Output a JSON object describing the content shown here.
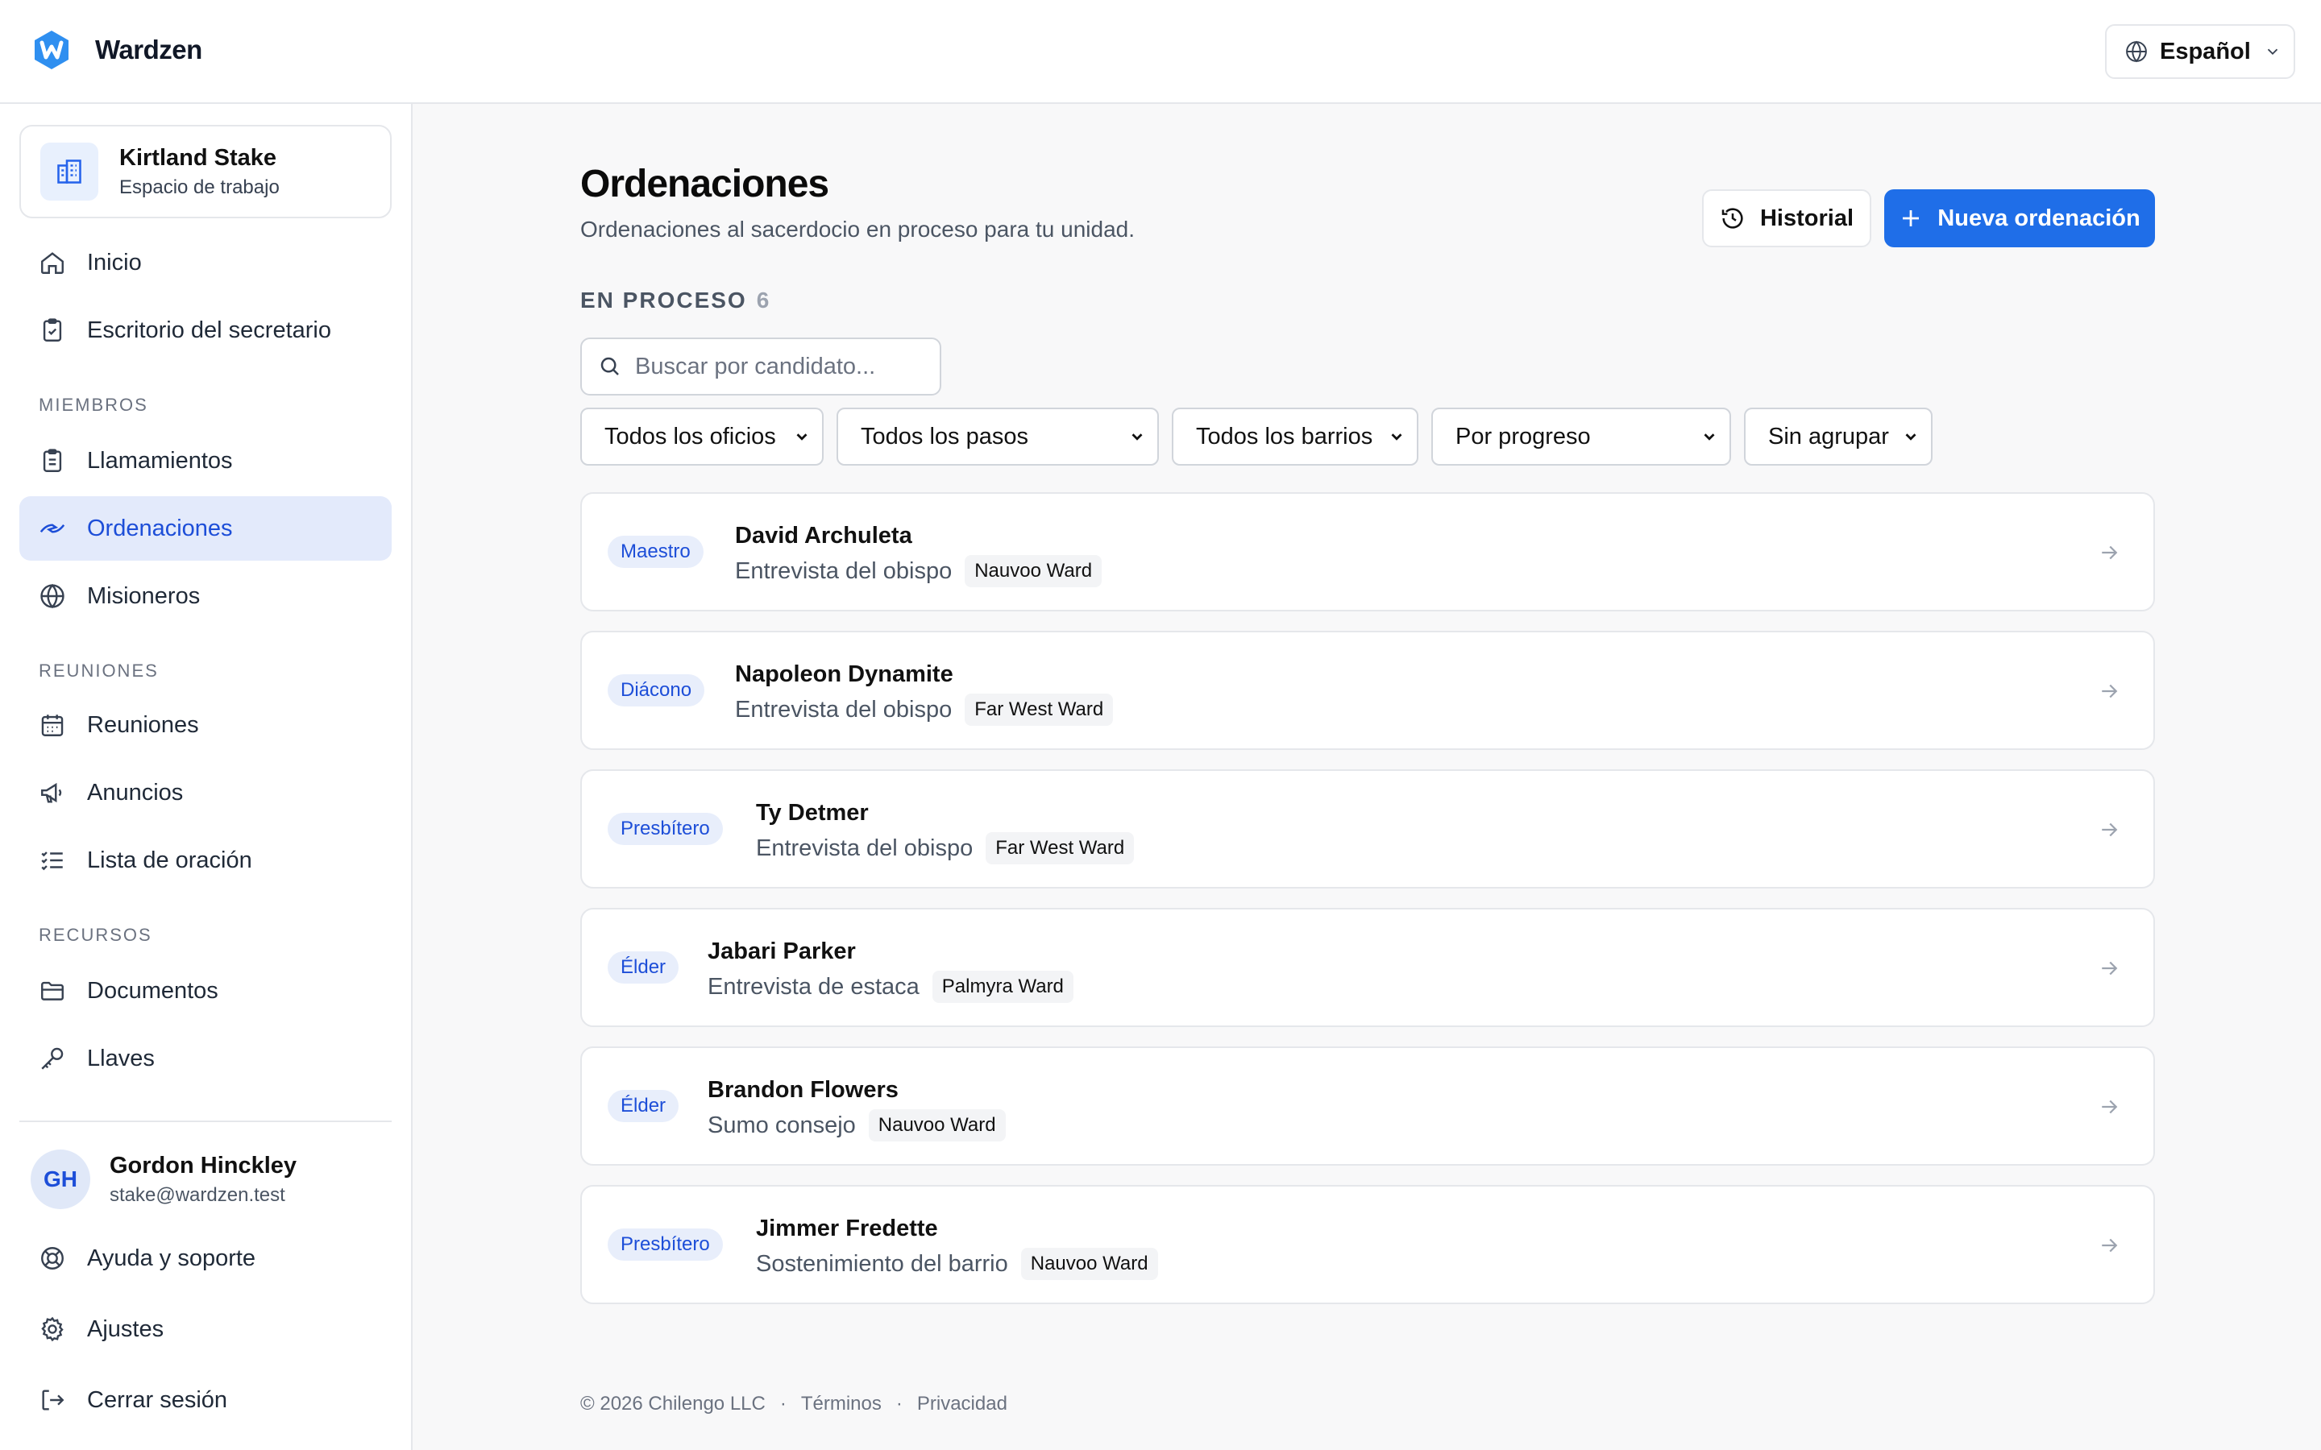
{
  "app": {
    "name": "Wardzen",
    "language": "Español"
  },
  "workspace": {
    "title": "Kirtland Stake",
    "subtitle": "Espacio de trabajo"
  },
  "nav": {
    "inicio": "Inicio",
    "escritorio": "Escritorio del secretario",
    "section_miembros": "MIEMBROS",
    "llamamientos": "Llamamientos",
    "ordenaciones": "Ordenaciones",
    "misioneros": "Misioneros",
    "section_reuniones": "REUNIONES",
    "reuniones": "Reuniones",
    "anuncios": "Anuncios",
    "lista": "Lista de oración",
    "section_recursos": "RECURSOS",
    "documentos": "Documentos",
    "llaves": "Llaves"
  },
  "user": {
    "initials": "GH",
    "name": "Gordon Hinckley",
    "email": "stake@wardzen.test"
  },
  "bottom_nav": {
    "ayuda": "Ayuda y soporte",
    "ajustes": "Ajustes",
    "cerrar": "Cerrar sesión"
  },
  "page": {
    "title": "Ordenaciones",
    "subtitle": "Ordenaciones al sacerdocio en proceso para tu unidad.",
    "history_button": "Historial",
    "new_button": "Nueva ordenación",
    "section_label": "EN PROCESO",
    "section_count": "6",
    "search_placeholder": "Buscar por candidato..."
  },
  "filters": {
    "oficios": "Todos los oficios",
    "pasos": "Todos los pasos",
    "barrios": "Todos los barrios",
    "orden": "Por progreso",
    "agrupar": "Sin agrupar"
  },
  "candidates": [
    {
      "role": "Maestro",
      "name": "David Archuleta",
      "step": "Entrevista del obispo",
      "ward": "Nauvoo Ward"
    },
    {
      "role": "Diácono",
      "name": "Napoleon Dynamite",
      "step": "Entrevista del obispo",
      "ward": "Far West Ward"
    },
    {
      "role": "Presbítero",
      "name": "Ty Detmer",
      "step": "Entrevista del obispo",
      "ward": "Far West Ward"
    },
    {
      "role": "Élder",
      "name": "Jabari Parker",
      "step": "Entrevista de estaca",
      "ward": "Palmyra Ward"
    },
    {
      "role": "Élder",
      "name": "Brandon Flowers",
      "step": "Sumo consejo",
      "ward": "Nauvoo Ward"
    },
    {
      "role": "Presbítero",
      "name": "Jimmer Fredette",
      "step": "Sostenimiento del barrio",
      "ward": "Nauvoo Ward"
    }
  ],
  "footer": {
    "copyright": "© 2026 Chilengo LLC",
    "dot1": "·",
    "terms": "Términos",
    "dot2": "·",
    "privacy": "Privacidad"
  },
  "colors": {
    "accent": "#1f6ee8",
    "active_bg": "#e3eafb",
    "badge_bg": "#e8eefb",
    "badge_text": "#1d4ed8"
  }
}
